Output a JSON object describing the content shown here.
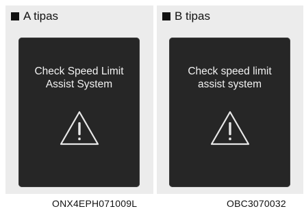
{
  "panels": [
    {
      "header": "A tipas",
      "message": "Check Speed Limit\nAssist System",
      "icon": "warning-triangle-icon",
      "code": "ONX4EPH071009L"
    },
    {
      "header": "B tipas",
      "message": "Check speed limit\nassist system",
      "icon": "warning-triangle-icon",
      "code": "OBC3070032"
    }
  ],
  "colors": {
    "panel_bg": "#ececec",
    "screen_bg": "#262626",
    "screen_text": "#f2f2f2"
  }
}
